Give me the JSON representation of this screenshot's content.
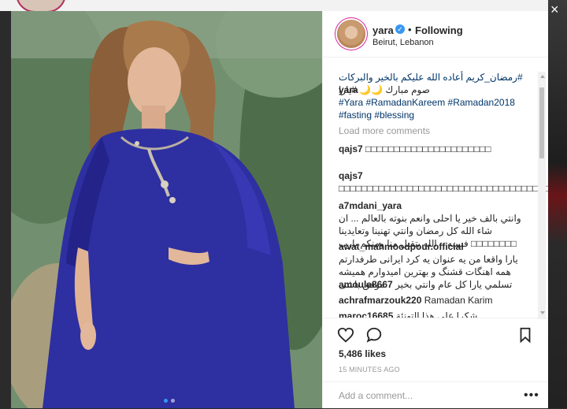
{
  "post": {
    "username": "yara",
    "following_label": "Following",
    "location": "Beirut, Lebanon"
  },
  "caption": {
    "username": "yara",
    "line1": "#رمضان_كريم أعاده الله عليكم بالخير والبركات",
    "line2": "صوم مبارك 🌙🌙 #يارا",
    "tags": "#Yara #RamadanKareem #Ramadan2018 #fasting #blessing"
  },
  "load_more": "Load more comments",
  "comments": [
    {
      "user": "qajs7",
      "text": "□□□□□□□□□□□□□□□□□□□□□□"
    },
    {
      "user": "qajs7",
      "text": "□□□□□□□□□□□□□□□□□□□□□□□□□□□□□□□□□□□□□□□□"
    },
    {
      "user": "a7mdani_yara",
      "text": "وانتي بالف خير يا احلى وانعم بنوته بالعالم ... ان شاء الله كل رمضان وانتي تهنينا وتعايدينا □□□□□□□□ فبيبيه .. الله يتقبل منا ومنكم يارب"
    },
    {
      "user": "awat_mahmoodpour.official",
      "text": "يارا واقعا من یه عنوان یه کرد ایرانی طرفدارتم همه اهنگات قشنگ و بهترین امیدوارم همیشه موفق باشی"
    },
    {
      "user": "amoula8667",
      "text": "تسلمي يارا كل عام وانتي بخير"
    },
    {
      "user": "achrafmarzouk220",
      "text": "Ramadan Karim"
    },
    {
      "user": "maroc16685",
      "text": "شكرا على هذا التهنئة"
    }
  ],
  "likes": "5,486 likes",
  "time": "15 MINUTES AGO",
  "add_comment_placeholder": "Add a comment...",
  "more_label": "•••",
  "colors": {
    "link": "#003569",
    "verified": "#3897f0",
    "dress": "#2e2fa0"
  },
  "icons": [
    "heart-icon",
    "comment-icon",
    "bookmark-icon",
    "verified-icon",
    "close-icon"
  ]
}
